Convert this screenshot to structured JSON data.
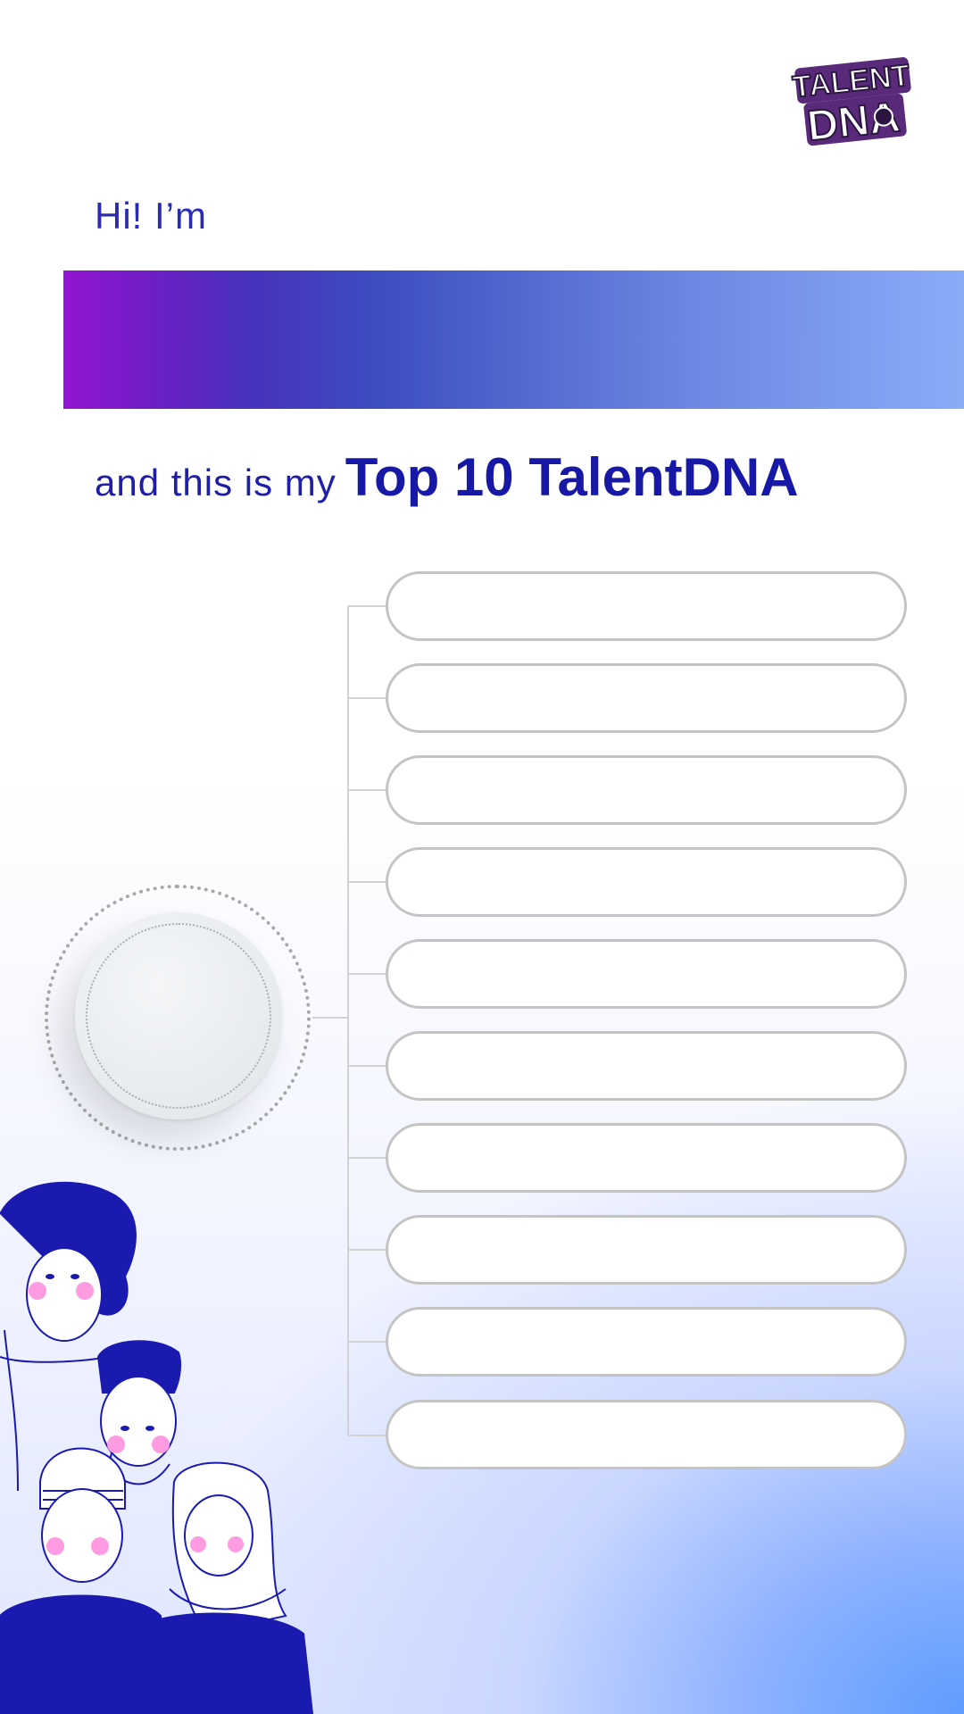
{
  "logo": {
    "line1": "TALENT",
    "line2": "DNA",
    "icon": "talentdna-logo"
  },
  "intro": {
    "greeting": "Hi! I’m",
    "name_value": ""
  },
  "headline": {
    "lead": "and this is my",
    "emphasis": "Top 10 TalentDNA"
  },
  "talent_slots": [
    "",
    "",
    "",
    "",
    "",
    "",
    "",
    "",
    "",
    ""
  ],
  "avatar": {
    "icon": "profile-photo-placeholder"
  },
  "illustration": {
    "icon": "people-illustration"
  },
  "colors": {
    "primary_text": "#1e1ea8",
    "banner_start": "#a914dc",
    "banner_end": "#89acf7",
    "slot_border": "#c4c4c4"
  }
}
